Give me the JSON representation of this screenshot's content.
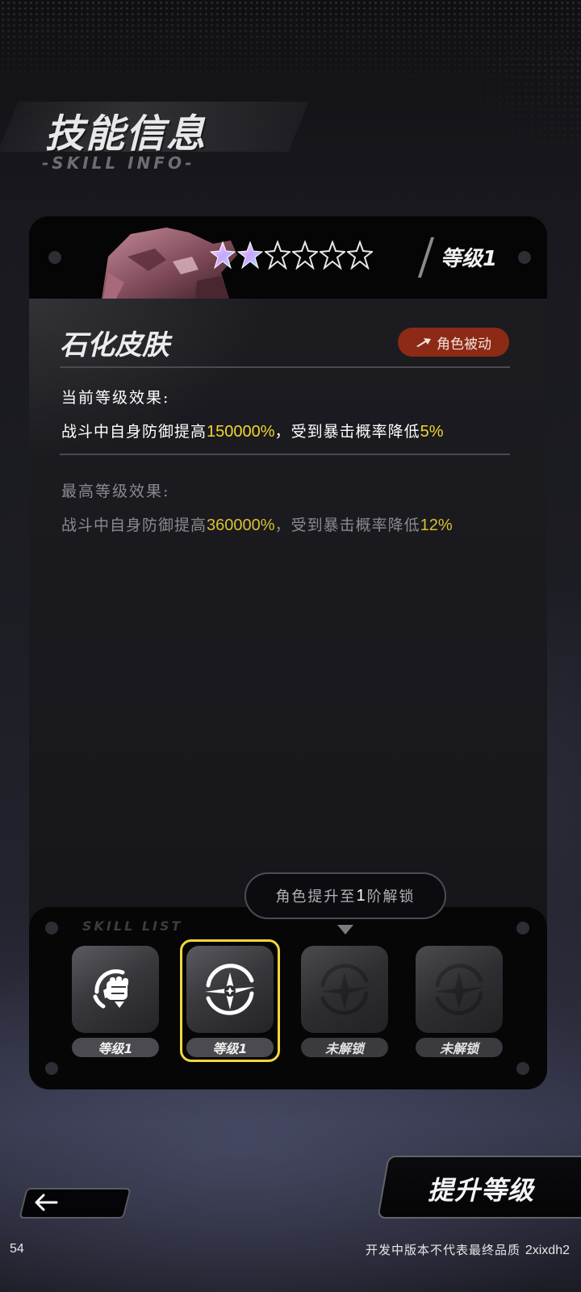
{
  "header": {
    "title": "技能信息",
    "subtitle": "-SKILL INFO-"
  },
  "card": {
    "stars_filled": 2,
    "stars_total": 6,
    "level_label": "等级1",
    "skill_name": "石化皮肤",
    "badge_label": "角色被动",
    "current": {
      "title": "当前等级效果:",
      "text_1": "战斗中自身防御提高",
      "value_1": "150000%",
      "sep": "，",
      "text_2": "受到暴击概率降低",
      "value_2": "5%"
    },
    "max": {
      "title": "最高等级效果:",
      "text_1": "战斗中自身防御提高",
      "value_1": "360000%",
      "sep": "，",
      "text_2": "受到暴击概率降低",
      "value_2": "12%"
    }
  },
  "tooltip": {
    "prefix": "角色提升至",
    "number": "1",
    "suffix": "阶解锁"
  },
  "tray": {
    "label": "SKILL LIST",
    "slots": [
      {
        "label": "等级1",
        "icon": "fist-icon",
        "state": "unlocked"
      },
      {
        "label": "等级1",
        "icon": "shield-star-icon",
        "state": "selected"
      },
      {
        "label": "未解锁",
        "icon": "shield-star-icon",
        "state": "locked"
      },
      {
        "label": "未解锁",
        "icon": "shield-star-icon",
        "state": "locked"
      }
    ]
  },
  "controls": {
    "back_icon": "arrow-left-icon",
    "upgrade_label": "提升等级"
  },
  "footer": {
    "left": "54",
    "right_text": "开发中版本不代表最终品质",
    "right_id": "2xixdh2"
  },
  "colors": {
    "highlight_value": "#f3d52f",
    "badge": "#8c2a16",
    "selected_frame": "#f5d63a"
  }
}
